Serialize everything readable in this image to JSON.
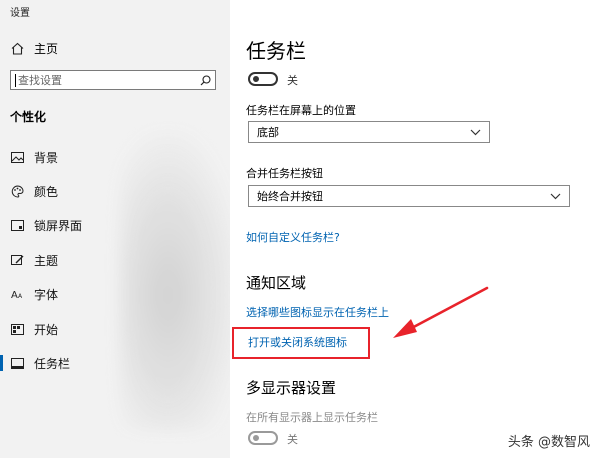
{
  "window": {
    "title": "设置"
  },
  "sidebar": {
    "home_label": "主页",
    "search_placeholder": "查找设置",
    "section_title": "个性化",
    "items": [
      {
        "label": "背景",
        "icon": "image-icon"
      },
      {
        "label": "颜色",
        "icon": "palette-icon"
      },
      {
        "label": "锁屏界面",
        "icon": "lock-screen-icon"
      },
      {
        "label": "主题",
        "icon": "theme-icon"
      },
      {
        "label": "字体",
        "icon": "font-icon"
      },
      {
        "label": "开始",
        "icon": "start-icon"
      },
      {
        "label": "任务栏",
        "icon": "taskbar-icon",
        "active": true
      }
    ]
  },
  "main": {
    "title": "任务栏",
    "toggle_top_label": "关",
    "position_label": "任务栏在屏幕上的位置",
    "position_value": "底部",
    "combine_label": "合并任务栏按钮",
    "combine_value": "始终合并按钮",
    "customize_link": "如何自定义任务栏?",
    "notification_heading": "通知区域",
    "select_icons_link": "选择哪些图标显示在任务栏上",
    "system_icons_link": "打开或关闭系统图标",
    "multi_display_heading": "多显示器设置",
    "show_all_displays_label": "在所有显示器上显示任务栏",
    "toggle_bottom_label": "关"
  },
  "colors": {
    "accent": "#0063b1",
    "highlight": "#e8232b"
  },
  "watermark": "头条 @数智风"
}
